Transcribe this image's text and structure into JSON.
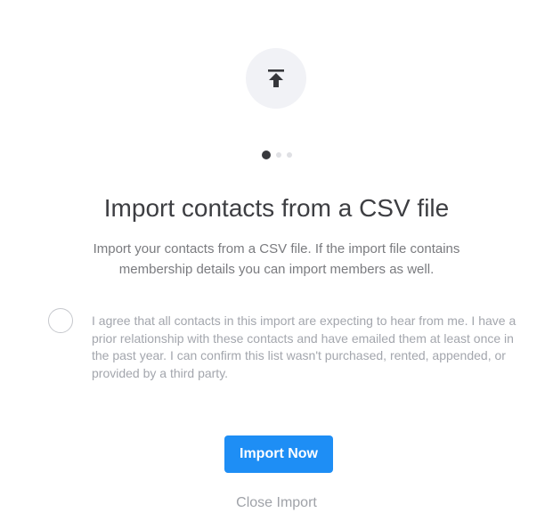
{
  "dialog": {
    "icon": "upload-to-top-icon",
    "steps": {
      "total": 3,
      "current": 1
    },
    "title": "Import contacts from a CSV file",
    "subtitle": "Import your contacts from a CSV file. If the import file contains membership details you can import members as well.",
    "consent": {
      "checked": false,
      "text": "I agree that all contacts in this import are expecting to hear from me. I have a prior relationship with these contacts and have emailed them at least once in the past year. I can confirm this list wasn't purchased, rented, appended, or provided by a third party."
    },
    "primary_button": "Import Now",
    "close_link": "Close Import"
  },
  "colors": {
    "primary": "#1e8ef5",
    "icon_bg": "#f1f2f6",
    "title": "#3d3e42",
    "muted": "#a3a6ad"
  }
}
